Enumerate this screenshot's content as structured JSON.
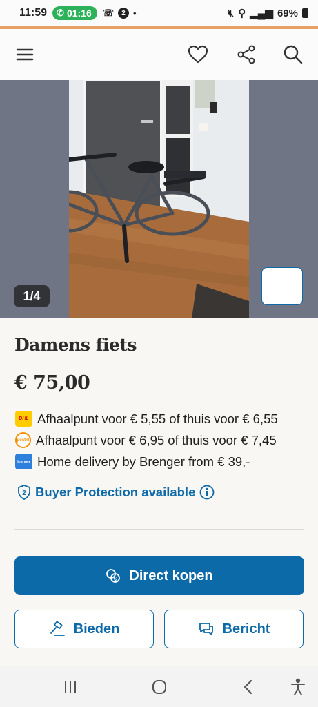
{
  "status_bar": {
    "time": "11:59",
    "call_timer": "01:16",
    "notif_count": "2",
    "battery": "69%"
  },
  "header": {
    "icons": [
      "menu-icon",
      "heart-icon",
      "share-icon",
      "search-icon"
    ]
  },
  "gallery": {
    "counter": "1/4"
  },
  "listing": {
    "title": "Damens fiets",
    "price": "€ 75,00"
  },
  "shipping": [
    {
      "logo": "DHL",
      "text": "Afhaalpunt voor € 5,55 of thuis voor € 6,55"
    },
    {
      "logo": "postnl",
      "text": "Afhaalpunt voor € 6,95 of thuis voor € 7,45"
    },
    {
      "logo": "brenger",
      "text": "Home delivery by Brenger from € 39,-"
    }
  ],
  "protection": {
    "label": "Buyer Protection available"
  },
  "actions": {
    "buy_label": "Direct kopen",
    "bid_label": "Bieden",
    "message_label": "Bericht"
  },
  "colors": {
    "accent": "#0d6aa8",
    "status_accent_line": "#e8a267",
    "call_green": "#2db15a"
  }
}
